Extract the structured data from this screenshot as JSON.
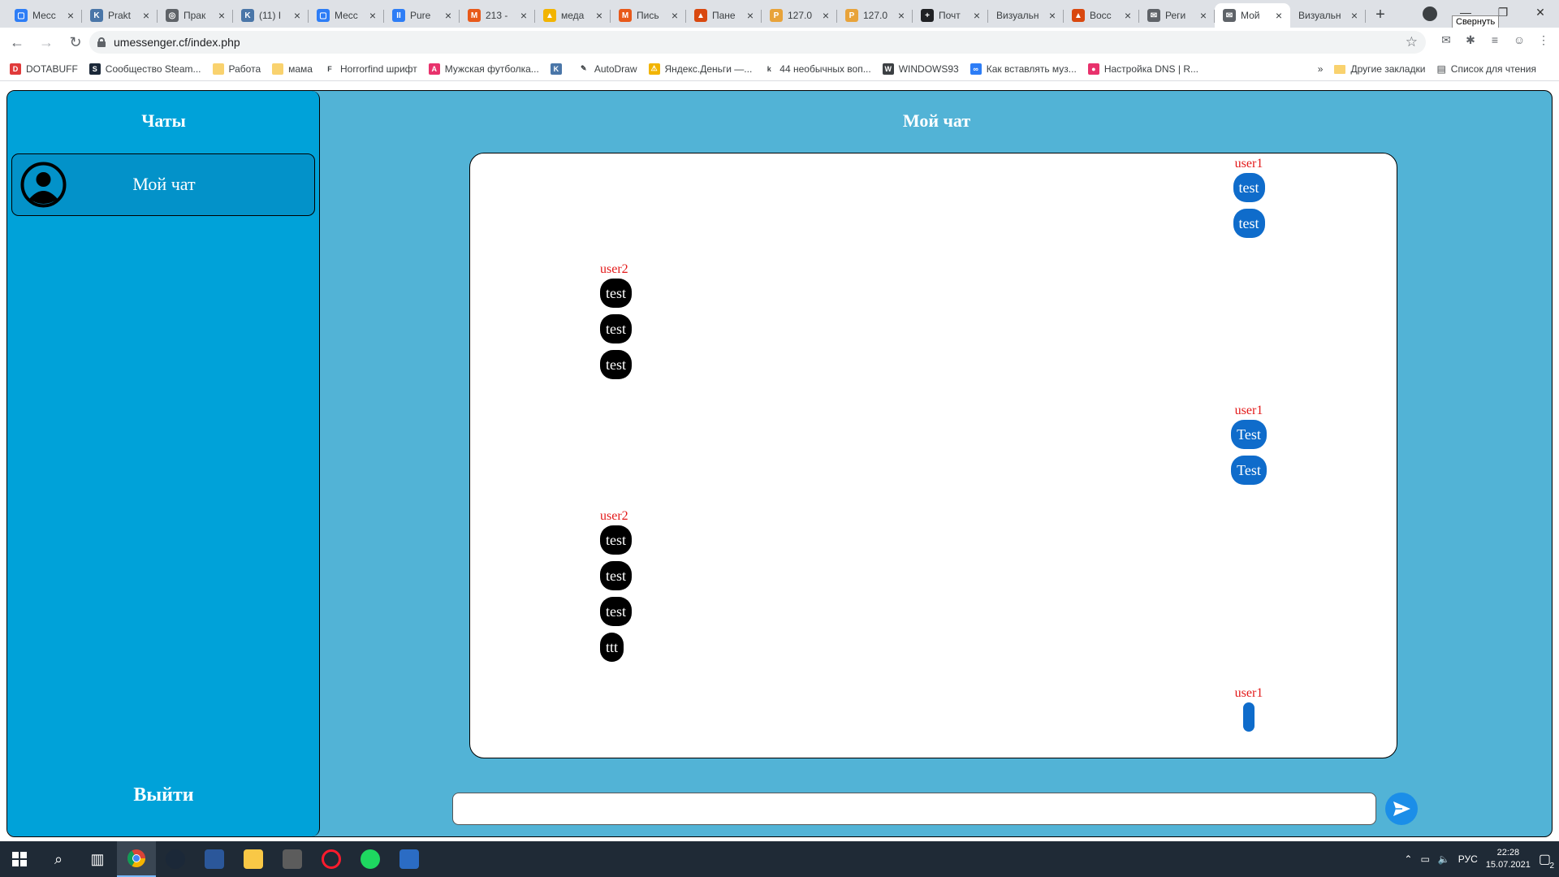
{
  "browser": {
    "tabs": [
      {
        "title": "Месс",
        "icon_color": "#2d7df6",
        "icon_char": "▢"
      },
      {
        "title": "Prakt",
        "icon_color": "#4a76a8",
        "icon_char": "K"
      },
      {
        "title": "Прак",
        "icon_color": "#5f6368",
        "icon_char": "◎"
      },
      {
        "title": "(11) I",
        "icon_color": "#4a76a8",
        "icon_char": "K"
      },
      {
        "title": "Месс",
        "icon_color": "#2d7df6",
        "icon_char": "▢"
      },
      {
        "title": "Pure",
        "icon_color": "#2d7df6",
        "icon_char": "II"
      },
      {
        "title": "213 -",
        "icon_color": "#e8591a",
        "icon_char": "M"
      },
      {
        "title": "меда",
        "icon_color": "#f2b400",
        "icon_char": "▲"
      },
      {
        "title": "Пись",
        "icon_color": "#e8591a",
        "icon_char": "M"
      },
      {
        "title": "Пане",
        "icon_color": "#d9480f",
        "icon_char": "▲"
      },
      {
        "title": "127.0",
        "icon_color": "#e8a33a",
        "icon_char": "P"
      },
      {
        "title": "127.0",
        "icon_color": "#e8a33a",
        "icon_char": "P"
      },
      {
        "title": "Почт",
        "icon_color": "#202124",
        "icon_char": "+"
      },
      {
        "title": "Визуальн",
        "icon_color": "",
        "icon_char": ""
      },
      {
        "title": "Восс",
        "icon_color": "#d9480f",
        "icon_char": "▲"
      },
      {
        "title": "Реги",
        "icon_color": "#5f6368",
        "icon_char": "✉"
      },
      {
        "title": "Мой",
        "icon_color": "#5f6368",
        "icon_char": "✉",
        "active": true
      },
      {
        "title": "Визуальн",
        "icon_color": "",
        "icon_char": ""
      }
    ],
    "tooltip": "Свернуть",
    "url": "umessenger.cf/index.php",
    "bookmarks": [
      {
        "label": "DOTABUFF",
        "icon_color": "#e03a3a",
        "icon_char": "D"
      },
      {
        "label": "Сообщество Steam...",
        "icon_color": "#1b2838",
        "icon_char": "S"
      },
      {
        "label": "Работа",
        "icon_color": "#f9d26e",
        "icon_char": ""
      },
      {
        "label": "мама",
        "icon_color": "#f9d26e",
        "icon_char": ""
      },
      {
        "label": "Horrorfind шрифт",
        "icon_color": "#ffffff",
        "icon_char": "F"
      },
      {
        "label": "Мужская футболка...",
        "icon_color": "#e8326c",
        "icon_char": "A"
      },
      {
        "label": "",
        "icon_color": "#4a76a8",
        "icon_char": "K"
      },
      {
        "label": "AutoDraw",
        "icon_color": "#ffffff",
        "icon_char": "✎"
      },
      {
        "label": "Яндекс.Деньги —...",
        "icon_color": "#f2b400",
        "icon_char": "⚠"
      },
      {
        "label": "44 необычных воп...",
        "icon_color": "#ffffff",
        "icon_char": "k"
      },
      {
        "label": "WINDOWS93",
        "icon_color": "#3c4043",
        "icon_char": "W"
      },
      {
        "label": "Как вставлять муз...",
        "icon_color": "#2d7df6",
        "icon_char": "∞"
      },
      {
        "label": "Настройка DNS | R...",
        "icon_color": "#e8326c",
        "icon_char": "●"
      }
    ],
    "bookmarks_right": {
      "more": "»",
      "other": "Другие закладки",
      "reading_list": "Список для чтения"
    }
  },
  "app": {
    "sidebar_title": "Чаты",
    "chats": [
      {
        "name": "Мой чат"
      }
    ],
    "logout_label": "Выйти",
    "chat_title": "Мой чат",
    "messages": [
      {
        "user": "user1",
        "side": "right",
        "texts": [
          "test",
          "test"
        ]
      },
      {
        "user": "user2",
        "side": "left",
        "texts": [
          "test",
          "test",
          "test"
        ]
      },
      {
        "user": "user1",
        "side": "right",
        "texts": [
          "Test",
          "Test"
        ]
      },
      {
        "user": "user2",
        "side": "left",
        "texts": [
          "test",
          "test",
          "test",
          "ttt"
        ]
      },
      {
        "user": "user1",
        "side": "right",
        "texts": [
          ""
        ]
      }
    ],
    "message_input": {
      "value": "",
      "placeholder": ""
    },
    "colors": {
      "panel": "#52b3d6",
      "sidebar": "#00a2d9",
      "user1_bubble": "#0f6ccb",
      "user2_bubble": "#000000",
      "username": "#e31919"
    }
  },
  "taskbar": {
    "language": "РУС",
    "time": "22:28",
    "date": "15.07.2021",
    "notifications": "2"
  }
}
